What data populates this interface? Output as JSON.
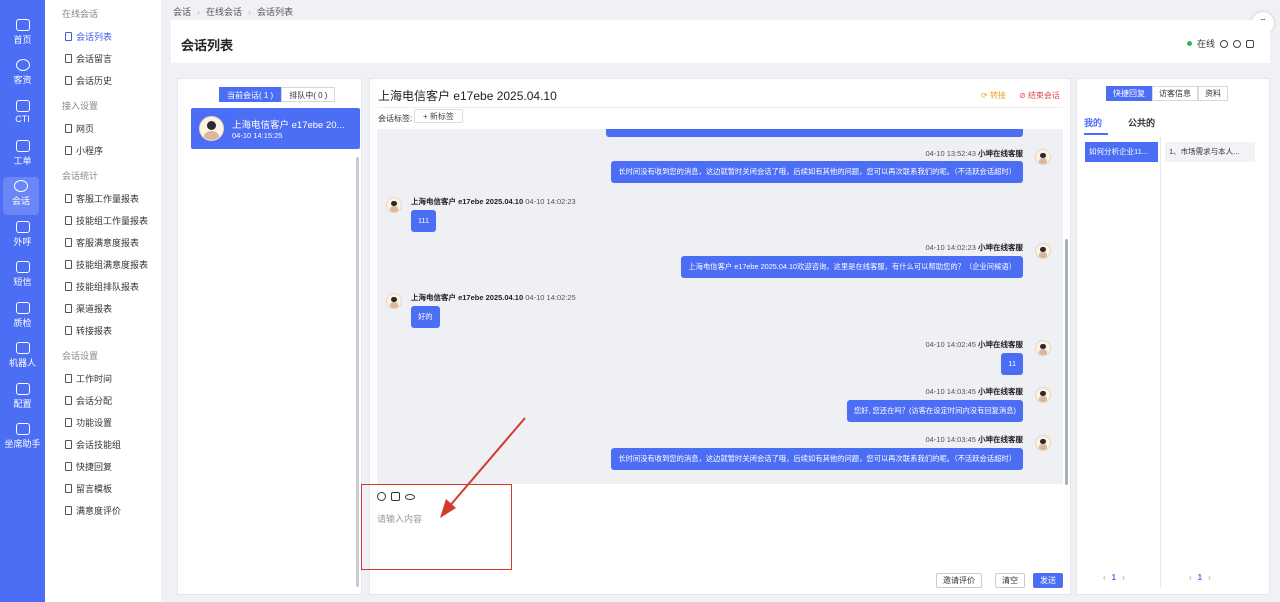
{
  "rail": [
    {
      "label": "首页",
      "icon": "home-icon"
    },
    {
      "label": "客资",
      "icon": "users-icon"
    },
    {
      "label": "CTI",
      "icon": "cti-icon"
    },
    {
      "label": "工单",
      "icon": "ticket-icon"
    },
    {
      "label": "会话",
      "icon": "chat-icon",
      "active": true
    },
    {
      "label": "外呼",
      "icon": "phone-icon"
    },
    {
      "label": "短信",
      "icon": "sms-icon"
    },
    {
      "label": "质检",
      "icon": "qa-icon"
    },
    {
      "label": "机器人",
      "icon": "robot-icon"
    },
    {
      "label": "配置",
      "icon": "config-icon"
    },
    {
      "label": "坐席助手",
      "icon": "assistant-icon"
    }
  ],
  "menu": {
    "group1": "在线会话",
    "g1": [
      "会话列表",
      "会话留言",
      "会话历史"
    ],
    "group2": "接入设置",
    "g2": [
      "网页",
      "小程序"
    ],
    "group3": "会话统计",
    "g3": [
      "客服工作量报表",
      "技能组工作量报表",
      "客服满意度报表",
      "技能组满意度报表",
      "技能组排队报表",
      "渠道报表",
      "转接报表"
    ],
    "group4": "会话设置",
    "g4": [
      "工作时间",
      "会话分配",
      "功能设置",
      "会话技能组",
      "快捷回复",
      "留言模板",
      "满意度评价"
    ]
  },
  "breadcrumb": [
    "会话",
    "在线会话",
    "会话列表"
  ],
  "header": {
    "title": "会话列表",
    "status": "在线"
  },
  "sessions": {
    "tab_current": "当前会话( 1 )",
    "tab_queue": "排队中( 0 )",
    "card_name": "上海电信客户 e17ebe 20...",
    "card_time": "04-10 14:15:25"
  },
  "chat": {
    "title": "上海电信客户 e17ebe 2025.04.10",
    "transfer": "转接",
    "end": "结束会话",
    "tag_label": "会话标签:",
    "new_tag": "+ 新标签",
    "placeholder": "请输入内容",
    "btn_invite": "邀请评价",
    "btn_clear": "清空",
    "btn_send": "发送",
    "messages": [
      {
        "side": "agent",
        "meta_time": "04-10 13:52:43",
        "meta_name": "小坤在线客服",
        "text": "长时间没有收到您的消息，这边就暂时关闭会话了哦，后续如有其他的问题，您可以再次联系我们的呢。（不活跃会话超时）"
      },
      {
        "side": "customer",
        "meta_name": "上海电信客户 e17ebe 2025.04.10",
        "meta_time": "04-10 14:02:23",
        "text": "111"
      },
      {
        "side": "agent",
        "meta_time": "04-10 14:02:23",
        "meta_name": "小坤在线客服",
        "text": "上海电信客户 e17ebe 2025.04.10欢迎咨询，这里是在线客服，有什么可以帮助您的？（企业问候语）"
      },
      {
        "side": "customer",
        "meta_name": "上海电信客户 e17ebe 2025.04.10",
        "meta_time": "04-10 14:02:25",
        "text": "好的"
      },
      {
        "side": "agent",
        "meta_time": "04-10 14:02:45",
        "meta_name": "小坤在线客服",
        "text": "11"
      },
      {
        "side": "agent",
        "meta_time": "04-10 14:03:45",
        "meta_name": "小坤在线客服",
        "text": "您好, 您还在吗？(访客在设定时间内没有回复消息)"
      },
      {
        "side": "agent",
        "meta_time": "04-10 14:03:45",
        "meta_name": "小坤在线客服",
        "text": "长时间没有收到您的消息，这边就暂时关闭会话了哦，后续如有其他的问题，您可以再次联系我们的呢。（不活跃会话超时）"
      }
    ]
  },
  "right": {
    "tabs": [
      "快捷回复",
      "访客信息",
      "资料"
    ],
    "sub_mine": "我的",
    "sub_public": "公共的",
    "card1": "如何分析企业11...",
    "card2": "1、市场需求与本人...",
    "page_left": "1",
    "page_right": "1",
    "prev": "‹",
    "next": "›"
  }
}
